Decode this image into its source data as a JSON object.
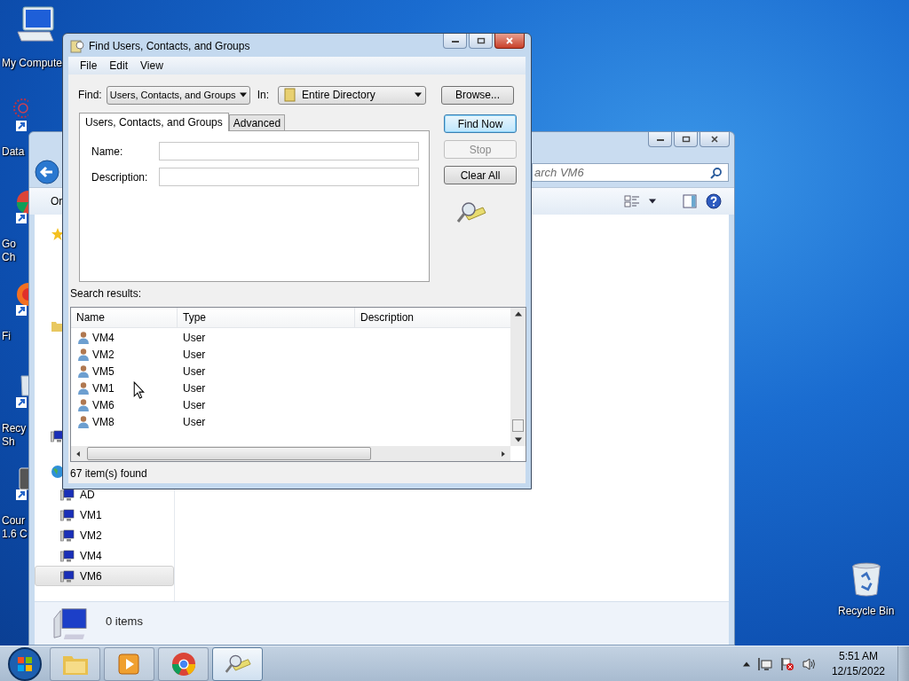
{
  "desktop_icons": [
    {
      "kind": "computer",
      "lines": [
        "My Compute"
      ]
    },
    {
      "kind": "network-art",
      "lines": [
        "Data"
      ]
    },
    {
      "kind": "chrome",
      "lines": [
        "Go",
        "Ch"
      ]
    },
    {
      "kind": "firefox",
      "lines": [
        "Fi"
      ]
    },
    {
      "kind": "recycle",
      "lines": [
        "Recy",
        "Sh"
      ]
    },
    {
      "kind": "app",
      "lines": [
        "Cour",
        "1.6 C"
      ]
    }
  ],
  "recycle_bin": {
    "label": "Recycle Bin"
  },
  "explorer": {
    "search": {
      "placeholder": "arch VM6"
    },
    "toolbar_button": "Or",
    "nav_items": [
      {
        "label": "AD",
        "selected": false
      },
      {
        "label": "VM1",
        "selected": false
      },
      {
        "label": "VM2",
        "selected": false
      },
      {
        "label": "VM4",
        "selected": false
      },
      {
        "label": "VM6",
        "selected": true
      }
    ],
    "details": "0 items"
  },
  "dialog": {
    "title": "Find Users, Contacts, and Groups",
    "menu": [
      "File",
      "Edit",
      "View"
    ],
    "find_label": "Find:",
    "find_value": "Users, Contacts, and Groups",
    "in_label": "In:",
    "in_value": "Entire Directory",
    "browse": "Browse...",
    "tabs": [
      {
        "label": "Users, Contacts, and Groups",
        "selected": true
      },
      {
        "label": "Advanced",
        "selected": false
      }
    ],
    "fields": [
      {
        "label": "Name:"
      },
      {
        "label": "Description:"
      }
    ],
    "buttons": [
      {
        "label": "Find Now",
        "disabled": false
      },
      {
        "label": "Stop",
        "disabled": true
      },
      {
        "label": "Clear All",
        "disabled": false
      }
    ],
    "results_label": "Search results:",
    "columns": [
      "Name",
      "Type",
      "Description"
    ],
    "rows": [
      {
        "name": "VM4",
        "type": "User"
      },
      {
        "name": "VM2",
        "type": "User"
      },
      {
        "name": "VM5",
        "type": "User"
      },
      {
        "name": "VM1",
        "type": "User"
      },
      {
        "name": "VM6",
        "type": "User"
      },
      {
        "name": "VM8",
        "type": "User"
      }
    ],
    "status": "67 item(s) found"
  },
  "taskbar": {
    "apps": [
      {
        "kind": "explorer",
        "selected": false
      },
      {
        "kind": "media",
        "selected": false
      },
      {
        "kind": "chrome",
        "selected": false
      },
      {
        "kind": "find",
        "selected": true
      }
    ],
    "time": "5:51 AM",
    "date": "12/15/2022"
  }
}
